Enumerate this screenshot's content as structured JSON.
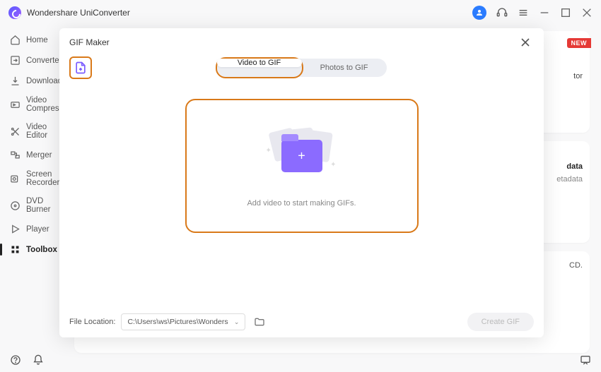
{
  "app": {
    "title": "Wondershare UniConverter"
  },
  "sidebar": {
    "items": [
      {
        "label": "Home"
      },
      {
        "label": "Converter"
      },
      {
        "label": "Downloader"
      },
      {
        "label": "Video Compressor"
      },
      {
        "label": "Video Editor"
      },
      {
        "label": "Merger"
      },
      {
        "label": "Screen Recorder"
      },
      {
        "label": "DVD Burner"
      },
      {
        "label": "Player"
      },
      {
        "label": "Toolbox"
      }
    ]
  },
  "background_panel": {
    "new_badge": "NEW",
    "residuals": {
      "r1": "tor",
      "r2": "data",
      "r3": "etadata",
      "r4": "CD."
    }
  },
  "dialog": {
    "title": "GIF Maker",
    "tabs": {
      "video": "Video to GIF",
      "photos": "Photos to GIF"
    },
    "drop_text": "Add video to start making GIFs.",
    "footer": {
      "location_label": "File Location:",
      "location_path": "C:\\Users\\ws\\Pictures\\Wonders",
      "create_label": "Create GIF"
    }
  }
}
